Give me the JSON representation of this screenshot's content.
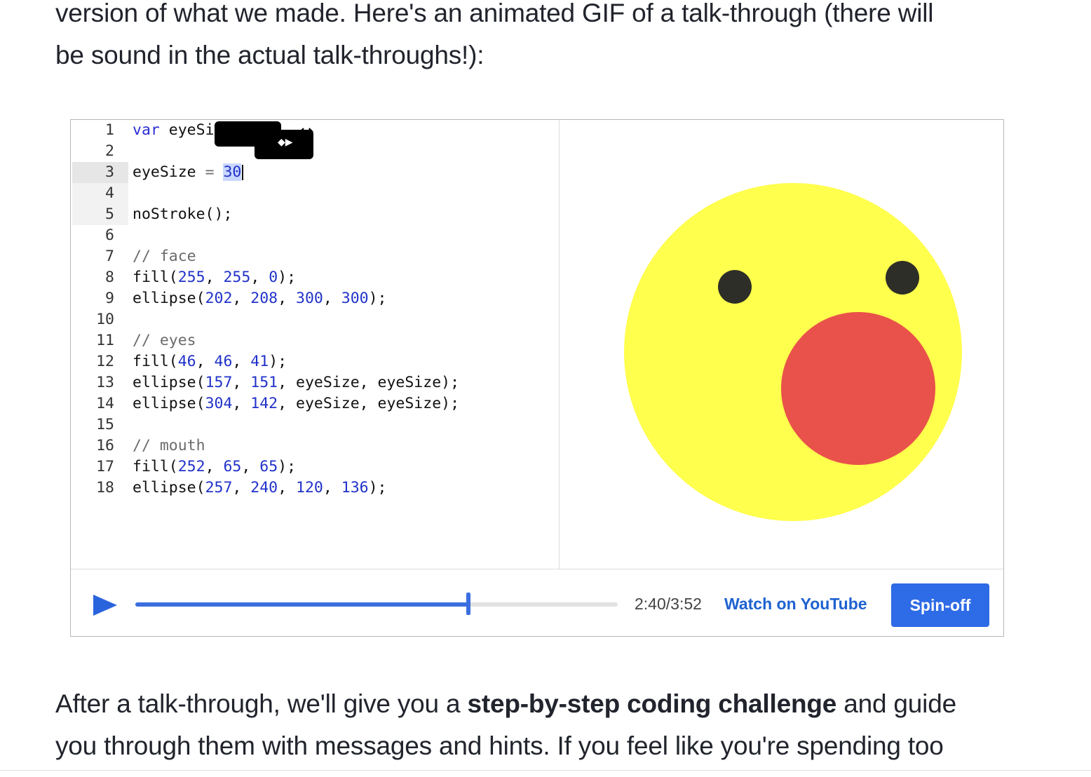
{
  "intro": {
    "line1": "version of what we made.  Here's an animated GIF of a talk-through (there will",
    "line2": "be sound in the actual talk-throughs!):"
  },
  "editor": {
    "lines": [
      {
        "n": "1",
        "parts": [
          {
            "t": "var",
            "c": "kw"
          },
          {
            "t": " eyeSi",
            "c": ""
          }
        ]
      },
      {
        "n": "2",
        "parts": []
      },
      {
        "n": "3",
        "parts": [
          {
            "t": "eyeSize ",
            "c": ""
          },
          {
            "t": "=",
            "c": "cmt"
          },
          {
            "t": " ",
            "c": ""
          },
          {
            "t": "30",
            "c": "sel"
          }
        ]
      },
      {
        "n": "4",
        "parts": []
      },
      {
        "n": "5",
        "parts": [
          {
            "t": "noStroke();",
            "c": ""
          }
        ]
      },
      {
        "n": "6",
        "parts": []
      },
      {
        "n": "7",
        "parts": [
          {
            "t": "// face",
            "c": "cmt"
          }
        ]
      },
      {
        "n": "8",
        "parts": [
          {
            "t": "fill(",
            "c": ""
          },
          {
            "t": "255",
            "c": "num"
          },
          {
            "t": ", ",
            "c": ""
          },
          {
            "t": "255",
            "c": "num"
          },
          {
            "t": ", ",
            "c": ""
          },
          {
            "t": "0",
            "c": "num"
          },
          {
            "t": ");",
            "c": ""
          }
        ]
      },
      {
        "n": "9",
        "parts": [
          {
            "t": "ellipse(",
            "c": ""
          },
          {
            "t": "202",
            "c": "num"
          },
          {
            "t": ", ",
            "c": ""
          },
          {
            "t": "208",
            "c": "num"
          },
          {
            "t": ", ",
            "c": ""
          },
          {
            "t": "300",
            "c": "num"
          },
          {
            "t": ", ",
            "c": ""
          },
          {
            "t": "300",
            "c": "num"
          },
          {
            "t": ");",
            "c": ""
          }
        ]
      },
      {
        "n": "10",
        "parts": []
      },
      {
        "n": "11",
        "parts": [
          {
            "t": "// eyes",
            "c": "cmt"
          }
        ]
      },
      {
        "n": "12",
        "parts": [
          {
            "t": "fill(",
            "c": ""
          },
          {
            "t": "46",
            "c": "num"
          },
          {
            "t": ", ",
            "c": ""
          },
          {
            "t": "46",
            "c": "num"
          },
          {
            "t": ", ",
            "c": ""
          },
          {
            "t": "41",
            "c": "num"
          },
          {
            "t": ");",
            "c": ""
          }
        ]
      },
      {
        "n": "13",
        "parts": [
          {
            "t": "ellipse(",
            "c": ""
          },
          {
            "t": "157",
            "c": "num"
          },
          {
            "t": ", ",
            "c": ""
          },
          {
            "t": "151",
            "c": "num"
          },
          {
            "t": ", eyeSize, eyeSize);",
            "c": ""
          }
        ]
      },
      {
        "n": "14",
        "parts": [
          {
            "t": "ellipse(",
            "c": ""
          },
          {
            "t": "304",
            "c": "num"
          },
          {
            "t": ", ",
            "c": ""
          },
          {
            "t": "142",
            "c": "num"
          },
          {
            "t": ", eyeSize, eyeSize);",
            "c": ""
          }
        ]
      },
      {
        "n": "15",
        "parts": []
      },
      {
        "n": "16",
        "parts": [
          {
            "t": "// mouth",
            "c": "cmt"
          }
        ]
      },
      {
        "n": "17",
        "parts": [
          {
            "t": "fill(",
            "c": ""
          },
          {
            "t": "252",
            "c": "num"
          },
          {
            "t": ", ",
            "c": ""
          },
          {
            "t": "65",
            "c": "num"
          },
          {
            "t": ", ",
            "c": ""
          },
          {
            "t": "65",
            "c": "num"
          },
          {
            "t": ");",
            "c": ""
          }
        ]
      },
      {
        "n": "18",
        "parts": [
          {
            "t": "ellipse(",
            "c": ""
          },
          {
            "t": "257",
            "c": "num"
          },
          {
            "t": ", ",
            "c": ""
          },
          {
            "t": "240",
            "c": "num"
          },
          {
            "t": ", ",
            "c": ""
          },
          {
            "t": "120",
            "c": "num"
          },
          {
            "t": ", ",
            "c": ""
          },
          {
            "t": "136",
            "c": "num"
          },
          {
            "t": ");",
            "c": ""
          }
        ]
      }
    ]
  },
  "canvas": {
    "face_color": "#ffff4d",
    "eye_color": "#2e2e29",
    "mouth_color": "#e9524a"
  },
  "controls": {
    "time": "2:40/3:52",
    "watch_label": "Watch on YouTube",
    "spinoff_label": "Spin-off",
    "progress": 0.69,
    "accent": "#3b6fe0"
  },
  "outro": {
    "line1_pre": "After a talk-through, we'll give you a ",
    "line1_bold": "step-by-step coding challenge",
    "line1_post": " and guide",
    "line2": "you through them with messages and hints. If you feel like you're spending too"
  }
}
